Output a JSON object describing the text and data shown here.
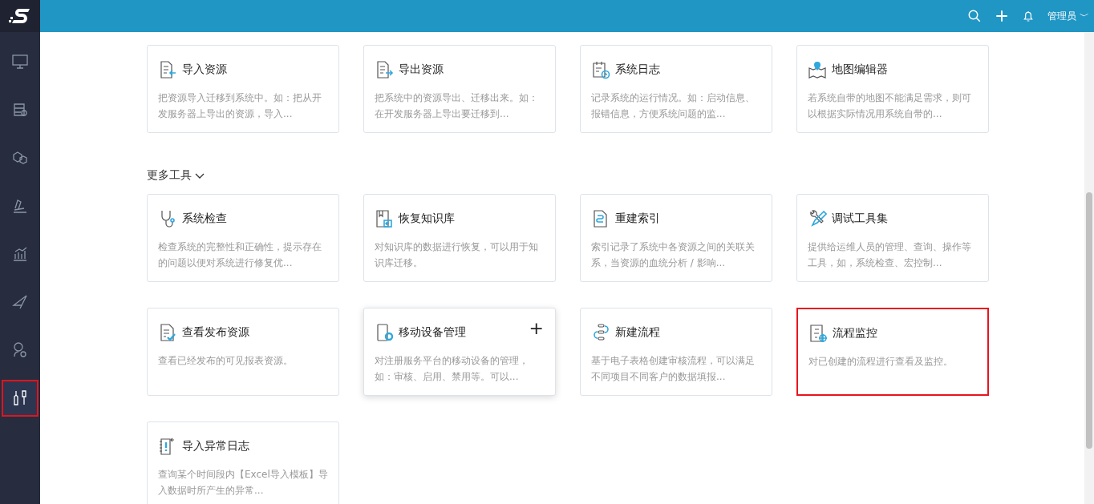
{
  "header": {
    "user": "管理员",
    "user_menu_caret": "﹀"
  },
  "sidebar": {
    "items": [
      {
        "selected": false
      },
      {
        "selected": false
      },
      {
        "selected": false
      },
      {
        "selected": false
      },
      {
        "selected": false
      },
      {
        "selected": false
      },
      {
        "selected": false
      },
      {
        "selected": true
      }
    ]
  },
  "tools": [
    {
      "title": "导入资源",
      "description": "把资源导入迁移到系统中。如：把从开发服务器上导出的资源，导入...",
      "hovered": false,
      "highlighted": false
    },
    {
      "title": "导出资源",
      "description": "把系统中的资源导出、迁移出来。如：在开发服务器上导出要迁移到...",
      "hovered": false,
      "highlighted": false
    },
    {
      "title": "系统日志",
      "description": "记录系统的运行情况。如：启动信息、报错信息，方便系统问题的监...",
      "hovered": false,
      "highlighted": false
    },
    {
      "title": "地图编辑器",
      "description": "若系统自带的地图不能满足需求，则可以根据实际情况用系统自带的...",
      "hovered": false,
      "highlighted": false
    }
  ],
  "more_tools": {
    "title": "更多工具",
    "expanded": true,
    "items": [
      {
        "title": "系统检查",
        "description": "检查系统的完整性和正确性，提示存在的问题以便对系统进行修复优...",
        "hovered": false,
        "highlighted": false
      },
      {
        "title": "恢复知识库",
        "description": "对知识库的数据进行恢复，可以用于知识库迁移。",
        "hovered": false,
        "highlighted": false
      },
      {
        "title": "重建索引",
        "description": "索引记录了系统中各资源之间的关联关系，当资源的血统分析 / 影响...",
        "hovered": false,
        "highlighted": false
      },
      {
        "title": "调试工具集",
        "description": "提供给运维人员的管理、查询、操作等工具，如，系统检查、宏控制...",
        "hovered": false,
        "highlighted": false
      },
      {
        "title": "查看发布资源",
        "description": "查看已经发布的可见报表资源。",
        "hovered": false,
        "highlighted": false
      },
      {
        "title": "移动设备管理",
        "description": "对注册服务平台的移动设备的管理，如：审核、启用、禁用等。可以...",
        "hovered": true,
        "highlighted": false,
        "action": "+"
      },
      {
        "title": "新建流程",
        "description": "基于电子表格创建审核流程，可以满足不同项目不同客户的数据填报...",
        "hovered": false,
        "highlighted": false
      },
      {
        "title": "流程监控",
        "description": "对已创建的流程进行查看及监控。",
        "hovered": false,
        "highlighted": true
      },
      {
        "title": "导入异常日志",
        "description": "查询某个时间段内【Excel导入模板】导入数据时所产生的异常...",
        "hovered": false,
        "highlighted": false
      }
    ]
  }
}
